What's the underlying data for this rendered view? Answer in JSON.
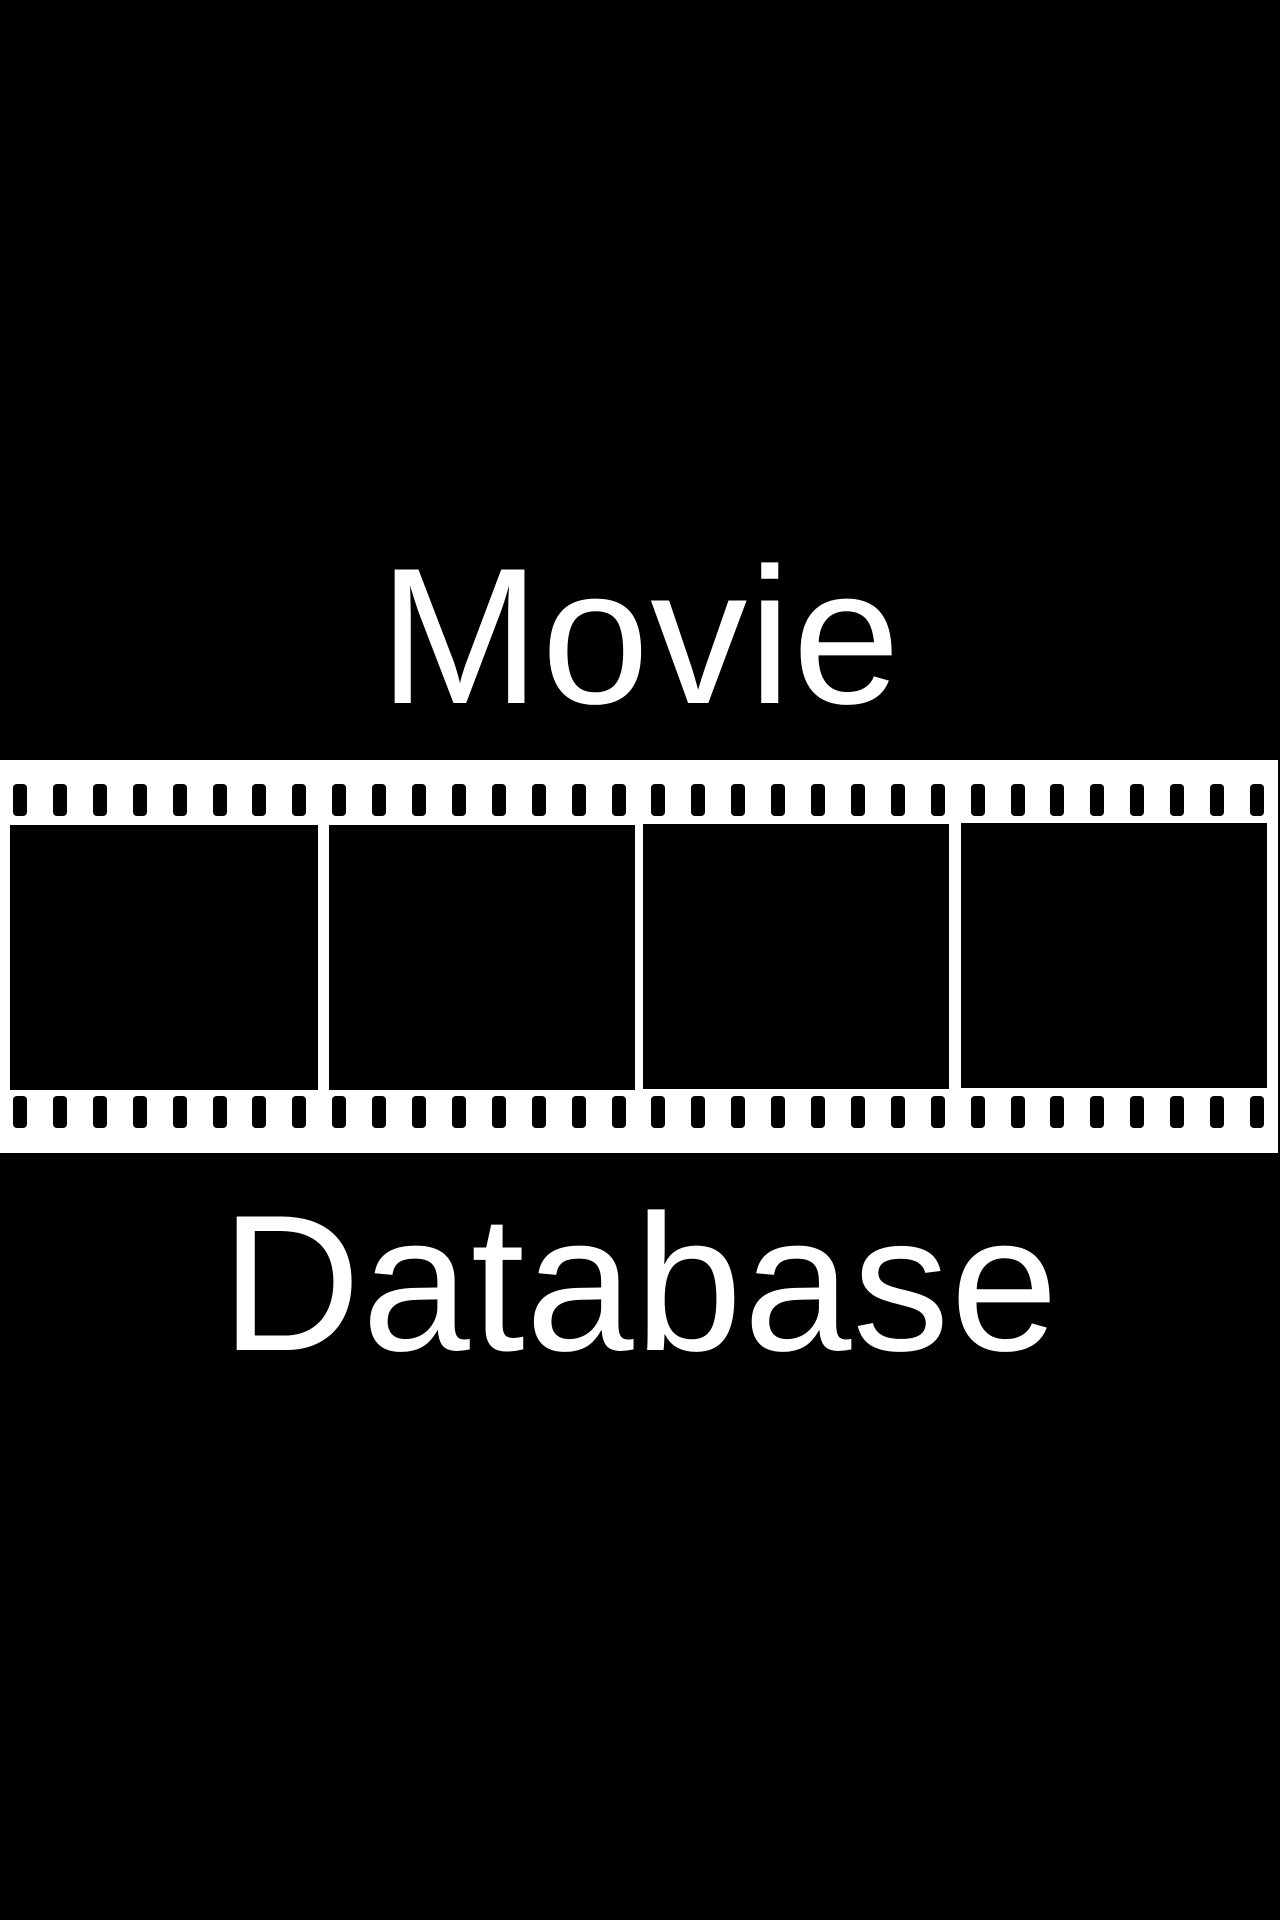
{
  "title": {
    "line1": "Movie",
    "line2": "Database"
  },
  "filmstrip": {
    "icon": "filmstrip-icon",
    "frame_count": 4,
    "perforations_per_row": 32,
    "colors": {
      "background": "#000000",
      "film": "#ffffff",
      "text": "#ffffff"
    }
  }
}
